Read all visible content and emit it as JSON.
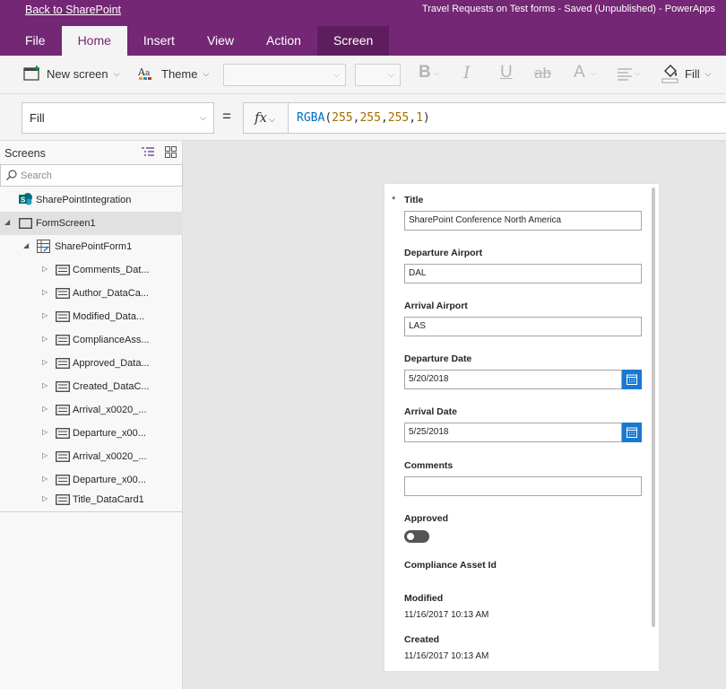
{
  "topbar": {
    "back_link": "Back to SharePoint",
    "app_title": "Travel Requests on Test forms - Saved (Unpublished) - PowerApps"
  },
  "tabs": [
    {
      "label": "File"
    },
    {
      "label": "Home"
    },
    {
      "label": "Insert"
    },
    {
      "label": "View"
    },
    {
      "label": "Action"
    },
    {
      "label": "Screen"
    }
  ],
  "ribbon": {
    "new_screen": "New screen",
    "theme": "Theme",
    "fill": "Fill"
  },
  "formula_bar": {
    "property": "Fill",
    "equals": "=",
    "fx": "fx",
    "formula": {
      "fn": "RGBA",
      "open": "(",
      "args": [
        "255",
        "255",
        "255",
        "1"
      ],
      "sep": ",",
      "close": ")"
    }
  },
  "screens_panel": {
    "title": "Screens",
    "search_placeholder": "Search",
    "tree": [
      {
        "label": "SharePointIntegration"
      },
      {
        "label": "FormScreen1"
      },
      {
        "label": "SharePointForm1"
      },
      {
        "label": "Comments_Dat..."
      },
      {
        "label": "Author_DataCa..."
      },
      {
        "label": "Modified_Data..."
      },
      {
        "label": "ComplianceAss..."
      },
      {
        "label": "Approved_Data..."
      },
      {
        "label": "Created_DataC..."
      },
      {
        "label": "Arrival_x0020_..."
      },
      {
        "label": "Departure_x00..."
      },
      {
        "label": "Arrival_x0020_..."
      },
      {
        "label": "Departure_x00..."
      },
      {
        "label": "Title_DataCard1"
      }
    ]
  },
  "form": {
    "required_marker": "*",
    "title": {
      "label": "Title",
      "value": "SharePoint Conference North America"
    },
    "departure_airport": {
      "label": "Departure Airport",
      "value": "DAL"
    },
    "arrival_airport": {
      "label": "Arrival Airport",
      "value": "LAS"
    },
    "departure_date": {
      "label": "Departure Date",
      "value": "5/20/2018"
    },
    "arrival_date": {
      "label": "Arrival Date",
      "value": "5/25/2018"
    },
    "comments": {
      "label": "Comments",
      "value": ""
    },
    "approved": {
      "label": "Approved",
      "on": false
    },
    "compliance_asset_id": {
      "label": "Compliance Asset Id"
    },
    "modified": {
      "label": "Modified",
      "value": "11/16/2017 10:13 AM"
    },
    "created": {
      "label": "Created",
      "value": "11/16/2017 10:13 AM"
    }
  },
  "colors": {
    "brand": "#742774",
    "ribbon_bg": "#f4f4f4",
    "canvas_bg": "#e6e6e6",
    "calendar_button": "#1b78d0"
  }
}
